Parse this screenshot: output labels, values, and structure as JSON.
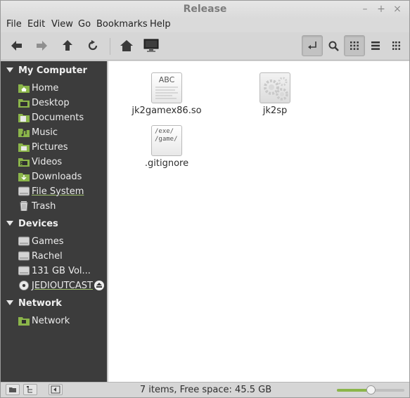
{
  "window": {
    "title": "Release",
    "minimize": "–",
    "maximize": "+",
    "close": "×"
  },
  "menu": [
    "File",
    "Edit",
    "View",
    "Go",
    "Bookmarks",
    "Help"
  ],
  "toolbar": {
    "back_icon": "back-arrow-icon",
    "forward_icon": "forward-arrow-icon",
    "up_icon": "up-arrow-icon",
    "reload_icon": "reload-icon",
    "home_icon": "home-icon",
    "computer_icon": "computer-icon",
    "toggle_location_icon": "location-toggle-icon",
    "search_icon": "search-icon",
    "icon_view_icon": "icon-view-icon",
    "list_view_icon": "list-view-icon",
    "compact_view_icon": "compact-view-icon",
    "active_view": "icons"
  },
  "sidebar": {
    "my_computer": {
      "title": "My Computer",
      "items": [
        {
          "label": "Home",
          "icon": "home-folder-icon"
        },
        {
          "label": "Desktop",
          "icon": "desktop-folder-icon"
        },
        {
          "label": "Documents",
          "icon": "documents-folder-icon"
        },
        {
          "label": "Music",
          "icon": "music-folder-icon"
        },
        {
          "label": "Pictures",
          "icon": "pictures-folder-icon"
        },
        {
          "label": "Videos",
          "icon": "videos-folder-icon"
        },
        {
          "label": "Downloads",
          "icon": "downloads-folder-icon"
        },
        {
          "label": "File System",
          "icon": "drive-icon"
        },
        {
          "label": "Trash",
          "icon": "trash-icon"
        }
      ]
    },
    "devices": {
      "title": "Devices",
      "items": [
        {
          "label": "Games",
          "icon": "drive-icon"
        },
        {
          "label": "Rachel",
          "icon": "drive-icon"
        },
        {
          "label": "131 GB Vol...",
          "icon": "drive-icon"
        },
        {
          "label": "JEDIOUTCAST",
          "icon": "optical-disc-icon"
        }
      ]
    },
    "network": {
      "title": "Network",
      "items": [
        {
          "label": "Network",
          "icon": "network-folder-icon"
        }
      ]
    }
  },
  "files": [
    {
      "name": "jk2gamex86.so",
      "icon": "text-file-icon",
      "preview": "ABC"
    },
    {
      "name": "jk2sp",
      "icon": "executable-gear-icon",
      "preview": ""
    },
    {
      "name": ".gitignore",
      "icon": "text-file-icon",
      "preview": "/exe/\n/game/"
    }
  ],
  "status": {
    "text": "7 items, Free space: 45.5 GB",
    "zoom_level": 0.5
  },
  "colors": {
    "accent": "#8bb54a",
    "sidebar_bg": "#3c3c3c"
  }
}
